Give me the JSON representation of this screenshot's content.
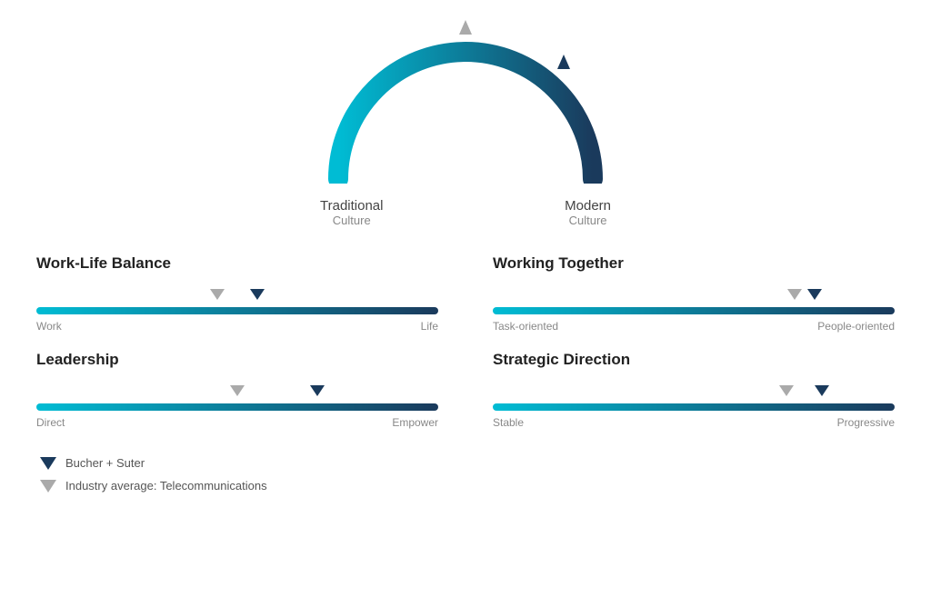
{
  "arch": {
    "left_label": "Traditional",
    "left_sublabel": "Culture",
    "right_label": "Modern",
    "right_sublabel": "Culture"
  },
  "sliders": [
    {
      "id": "work-life-balance",
      "title": "Work-Life Balance",
      "left_label": "Work",
      "right_label": "Life",
      "industry_pct": 45,
      "company_pct": 55
    },
    {
      "id": "working-together",
      "title": "Working Together",
      "left_label": "Task-oriented",
      "right_label": "People-oriented",
      "industry_pct": 75,
      "company_pct": 80
    },
    {
      "id": "leadership",
      "title": "Leadership",
      "left_label": "Direct",
      "right_label": "Empower",
      "industry_pct": 50,
      "company_pct": 70
    },
    {
      "id": "strategic-direction",
      "title": "Strategic Direction",
      "left_label": "Stable",
      "right_label": "Progressive",
      "industry_pct": 73,
      "company_pct": 82
    }
  ],
  "legend": [
    {
      "type": "navy",
      "label": "Bucher + Suter"
    },
    {
      "type": "gray",
      "label": "Industry average: Telecommunications"
    }
  ]
}
